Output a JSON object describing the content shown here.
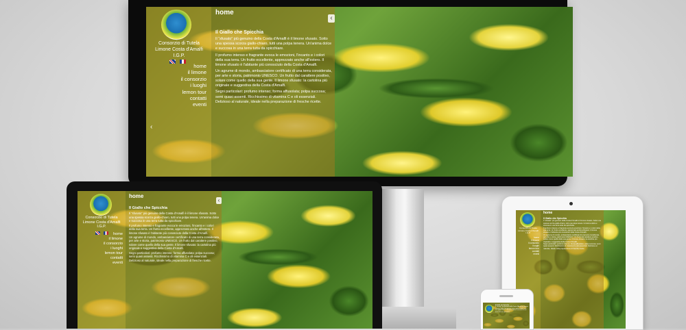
{
  "site": {
    "org_line1": "Consorzio di Tutela",
    "org_line2": "Limone Costa d'Amalfi I.G.P.",
    "page_title": "home",
    "nav": [
      "home",
      "il limone",
      "il consorzio",
      "i luoghi",
      "lemon tour",
      "contatti",
      "eventi"
    ],
    "heading": "Il Giallo che Spicchia",
    "paragraphs": [
      "Il “sfusato” più genuino della Costa d'Amalfi è il limone sfusato. Sotto una spessa scorza giallo-chiaro, tutti una polpa tenera. Un'anima dolce e succosa in una terra tutta da spicchiare.",
      "Il profumo intenso e fragrante evoca le emozioni, l'incanto e i colori della sua terra. Un frutto eccellente, apprezzato anche all'estero. Il limone sfusato è l'abitante più conosciuto della Costa d'Amalfi.",
      "Un agrume di mondo, ambasciatore certificato di una terra considerata, per arte e storia, patrimonio UNESCO. Un frutto dal carattere positivo, solare come quello della sua gente. Il limone sfusato: la cartolina più originale e suggestiva della Costa d'Amalfi.",
      "Segni particolari: profumo intenso; forma affusolata; polpa succosa; semi quasi assenti. Ricchissimo di vitamina C e oli essenziali. Delizioso al naturale, ideale nella preparazione di fresche ricette."
    ],
    "prev_glyph": "‹",
    "side_arrow_glyph": "‹"
  },
  "icons": {
    "logo": "consortium-logo",
    "flag_uk": "uk-flag-icon",
    "flag_it": "italy-flag-icon",
    "camera": "camera-dot-icon",
    "home_button": "home-button-icon"
  },
  "colors": {
    "background": "#d9d9d9",
    "bezel_dark": "#0b0b0b",
    "panel_tint": "#c8962a",
    "lemon": "#f3e44a",
    "leaf": "#3d6e1f"
  }
}
